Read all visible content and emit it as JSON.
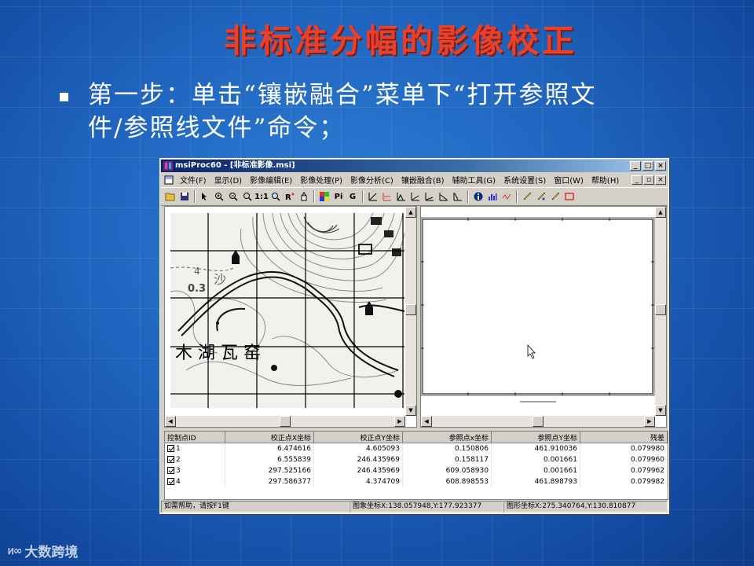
{
  "slide": {
    "title": "非标准分幅的影像校正",
    "bullet_line1": "第一步：单击“镶嵌融合”菜单下“打开参照文",
    "bullet_line2": "件/参照线文件”命令；"
  },
  "window": {
    "title": "msiProc60 - [非标准影像.msi]",
    "menu": [
      "文件(F)",
      "显示(D)",
      "影像编辑(E)",
      "影像处理(P)",
      "影像分析(C)",
      "镶嵌融合(B)",
      "辅助工具(G)",
      "系统设置(S)",
      "窗口(W)",
      "帮助(H)"
    ],
    "toolbar_text": {
      "one_to_one": "1:1",
      "pi": "Pi",
      "g": "G"
    }
  },
  "map": {
    "labels": {
      "sand": "沙",
      "num1": "4",
      "num2": "0.3",
      "place": "木 湖 瓦 窑"
    }
  },
  "table": {
    "headers": [
      "控制点ID",
      "校正点X坐标",
      "校正点Y坐标",
      "参照点x坐标",
      "参照点Y坐标",
      "残差"
    ],
    "rows": [
      [
        "1",
        "6.474616",
        "4.605093",
        "0.150806",
        "461.910036",
        "0.079980"
      ],
      [
        "2",
        "6.555839",
        "246.435969",
        "0.158117",
        "0.001661",
        "0.079960"
      ],
      [
        "3",
        "297.525166",
        "246.435969",
        "609.058930",
        "0.001661",
        "0.079962"
      ],
      [
        "4",
        "297.586377",
        "4.374709",
        "608.898553",
        "461.898793",
        "0.079982"
      ]
    ]
  },
  "status": {
    "help": "如需帮助，请按F1键",
    "image_coord": "图象坐标X:138.057948,Y:177.923377",
    "graphic_coord": "图形坐标X:275.340764,Y:130.810877"
  },
  "watermark": {
    "logo": "ᥢ∞",
    "text": "大数跨境"
  },
  "colors": {
    "title": "#e8402a",
    "background": "#1f64be",
    "window": "#d4d0c8"
  }
}
